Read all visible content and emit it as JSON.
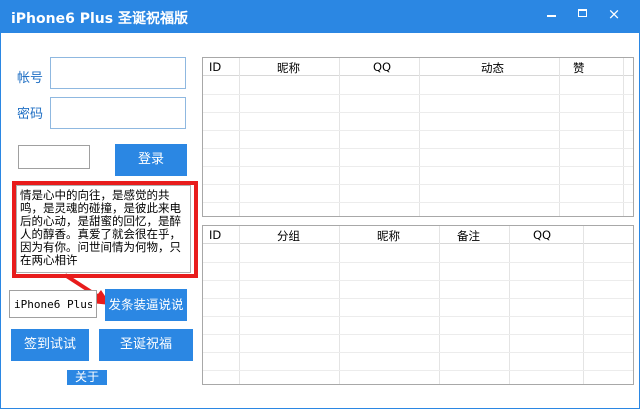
{
  "window": {
    "title": "iPhone6 Plus 圣诞祝福版",
    "controls": {
      "minimize": "",
      "maximize": "",
      "close": "×"
    }
  },
  "login": {
    "account_label": "帐号",
    "account_value": "",
    "password_label": "密码",
    "password_value": "",
    "captcha_value": "",
    "login_button": "登录"
  },
  "message": {
    "text": "情是心中的向往，是感觉的共鸣，是灵魂的碰撞，是彼此来电后的心动，是甜蜜的回忆，是醉人的醇香。真爱了就会很在乎，因为有你。问世间情为何物，只在两心相许"
  },
  "device": {
    "model_value": "iPhone6 Plus",
    "post_button": "发条装逼说说"
  },
  "actions": {
    "checkin_button": "签到试试",
    "christmas_button": "圣诞祝福",
    "about_button": "关于"
  },
  "friends_table": {
    "columns": [
      "ID",
      "昵称",
      "QQ",
      "动态",
      "赞"
    ]
  },
  "groups_table": {
    "columns": [
      "ID",
      "分组",
      "昵称",
      "备注",
      "QQ"
    ]
  },
  "colors": {
    "accent": "#2b87e3",
    "highlight": "#e81c1c",
    "label": "#1f6fc4"
  }
}
